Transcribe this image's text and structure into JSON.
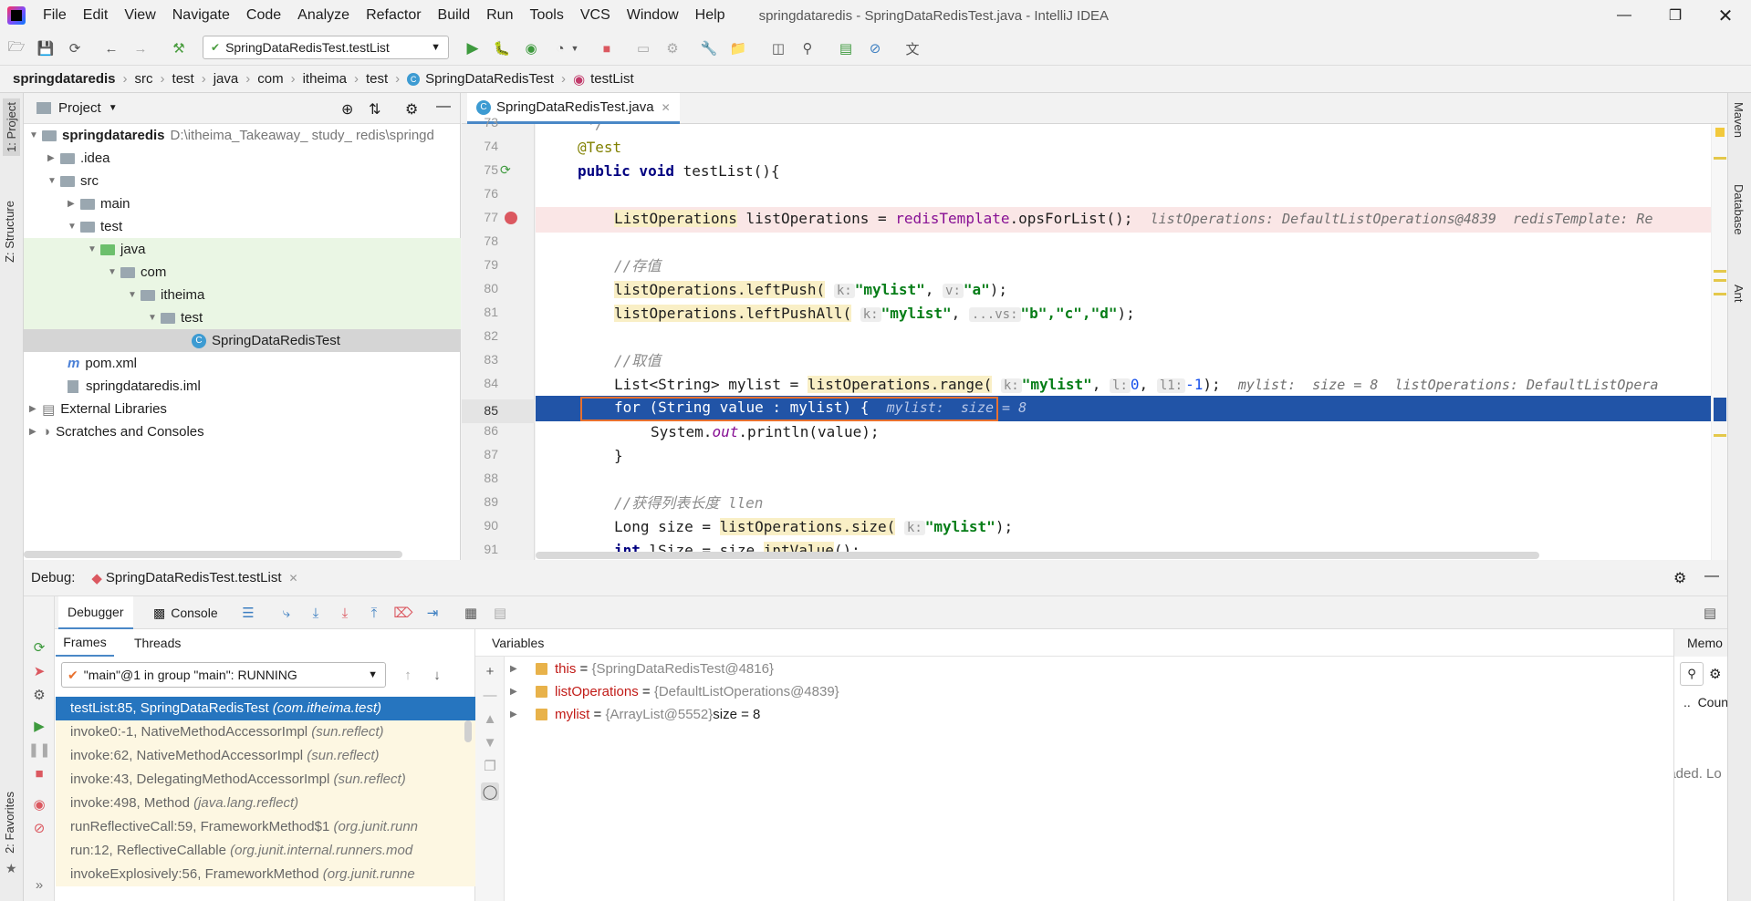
{
  "menu": [
    "File",
    "Edit",
    "View",
    "Navigate",
    "Code",
    "Analyze",
    "Refactor",
    "Build",
    "Run",
    "Tools",
    "VCS",
    "Window",
    "Help"
  ],
  "window_title": "springdataredis - SpringDataRedisTest.java - IntelliJ IDEA",
  "run_config": "SpringDataRedisTest.testList",
  "breadcrumb": [
    "springdataredis",
    "src",
    "test",
    "java",
    "com",
    "itheima",
    "test",
    "SpringDataRedisTest",
    "testList"
  ],
  "left_stripe": {
    "project": "1: Project",
    "structure": "Z: Structure",
    "favorites": "2: Favorites"
  },
  "right_stripe": [
    "Maven",
    "Database",
    "Ant"
  ],
  "project": {
    "title": "Project",
    "root_name": "springdataredis",
    "root_path": "D:\\itheima_Takeaway_ study_ redis\\springd",
    "items": [
      ".idea",
      "src",
      "main",
      "test",
      "java",
      "com",
      "itheima",
      "test",
      "SpringDataRedisTest",
      "pom.xml",
      "springdataredis.iml",
      "External Libraries",
      "Scratches and Consoles"
    ]
  },
  "editor": {
    "tab": "SpringDataRedisTest.java",
    "line_numbers": [
      "73",
      "74",
      "75",
      "76",
      "77",
      "78",
      "79",
      "80",
      "81",
      "82",
      "83",
      "84",
      "85",
      "86",
      "87",
      "88",
      "89",
      "90",
      "91"
    ],
    "lines": {
      "l73": "*/",
      "l74": "@Test",
      "l75a": "public void ",
      "l75b": "testList(){",
      "l77a": "ListOperations",
      "l77b": " listOperations = ",
      "l77c": "redisTemplate",
      "l77d": ".opsForList();",
      "l77hint": "listOperations: DefaultListOperations@4839  redisTemplate: Re",
      "l79": "//存值",
      "l80a": "listOperations.leftPush(",
      "l80k": "k:",
      "l80s1": "\"mylist\"",
      "l80v": "v:",
      "l80s2": "\"a\"",
      "l80e": ");",
      "l81a": "listOperations.leftPushAll(",
      "l81k": "k:",
      "l81s1": "\"mylist\"",
      "l81v": "...vs:",
      "l81s2": "\"b\",\"c\",\"d\"",
      "l81e": ");",
      "l83": "//取值",
      "l84a": "List<String> mylist = ",
      "l84b": "listOperations.range(",
      "l84k": "k:",
      "l84s": "\"mylist\"",
      "l84l": "l:",
      "l84n1": "0",
      "l84l1": "l1:",
      "l84n2": "-1",
      "l84e": ");",
      "l84hint": "mylist:  size = 8  listOperations: DefaultListOpera",
      "l85": "for (String value : mylist) {",
      "l85hint": "mylist:  size = 8",
      "l86a": "System.",
      "l86b": "out",
      "l86c": ".println(value);",
      "l87": "}",
      "l89": "//获得列表长度 llen",
      "l90a": "Long size = ",
      "l90b": "listOperations.size(",
      "l90k": "k:",
      "l90s": "\"mylist\"",
      "l90e": ");",
      "l91a": "int",
      "l91b": " lSize = size.",
      "l91c": "intValue",
      "l91d": "();"
    }
  },
  "debug": {
    "label": "Debug:",
    "session": "SpringDataRedisTest.testList",
    "tabs": {
      "debugger": "Debugger",
      "console": "Console"
    },
    "frames_tab": "Frames",
    "threads_tab": "Threads",
    "thread": "\"main\"@1 in group \"main\": RUNNING",
    "frames": [
      {
        "method": "testList:85, SpringDataRedisTest",
        "pkg": "(com.itheima.test)"
      },
      {
        "method": "invoke0:-1, NativeMethodAccessorImpl",
        "pkg": "(sun.reflect)"
      },
      {
        "method": "invoke:62, NativeMethodAccessorImpl",
        "pkg": "(sun.reflect)"
      },
      {
        "method": "invoke:43, DelegatingMethodAccessorImpl",
        "pkg": "(sun.reflect)"
      },
      {
        "method": "invoke:498, Method",
        "pkg": "(java.lang.reflect)"
      },
      {
        "method": "runReflectiveCall:59, FrameworkMethod$1",
        "pkg": "(org.junit.runn"
      },
      {
        "method": "run:12, ReflectiveCallable",
        "pkg": "(org.junit.internal.runners.mod"
      },
      {
        "method": "invokeExplosively:56, FrameworkMethod",
        "pkg": "(org.junit.runne"
      }
    ],
    "variables_title": "Variables",
    "variables": [
      {
        "name": "this",
        "value": "{SpringDataRedisTest@4816}",
        "extra": ""
      },
      {
        "name": "listOperations",
        "value": "{DefaultListOperations@4839}",
        "extra": ""
      },
      {
        "name": "mylist",
        "value": "{ArrayList@5552}",
        "extra": " size = 8"
      }
    ],
    "memory": {
      "title": "Memo",
      "count": "Count",
      "loaded": "s loaded. Lo"
    }
  },
  "colors": {
    "exec_line": "#2154a7",
    "breakpoint": "#db5860",
    "selection": "#2675bf"
  }
}
